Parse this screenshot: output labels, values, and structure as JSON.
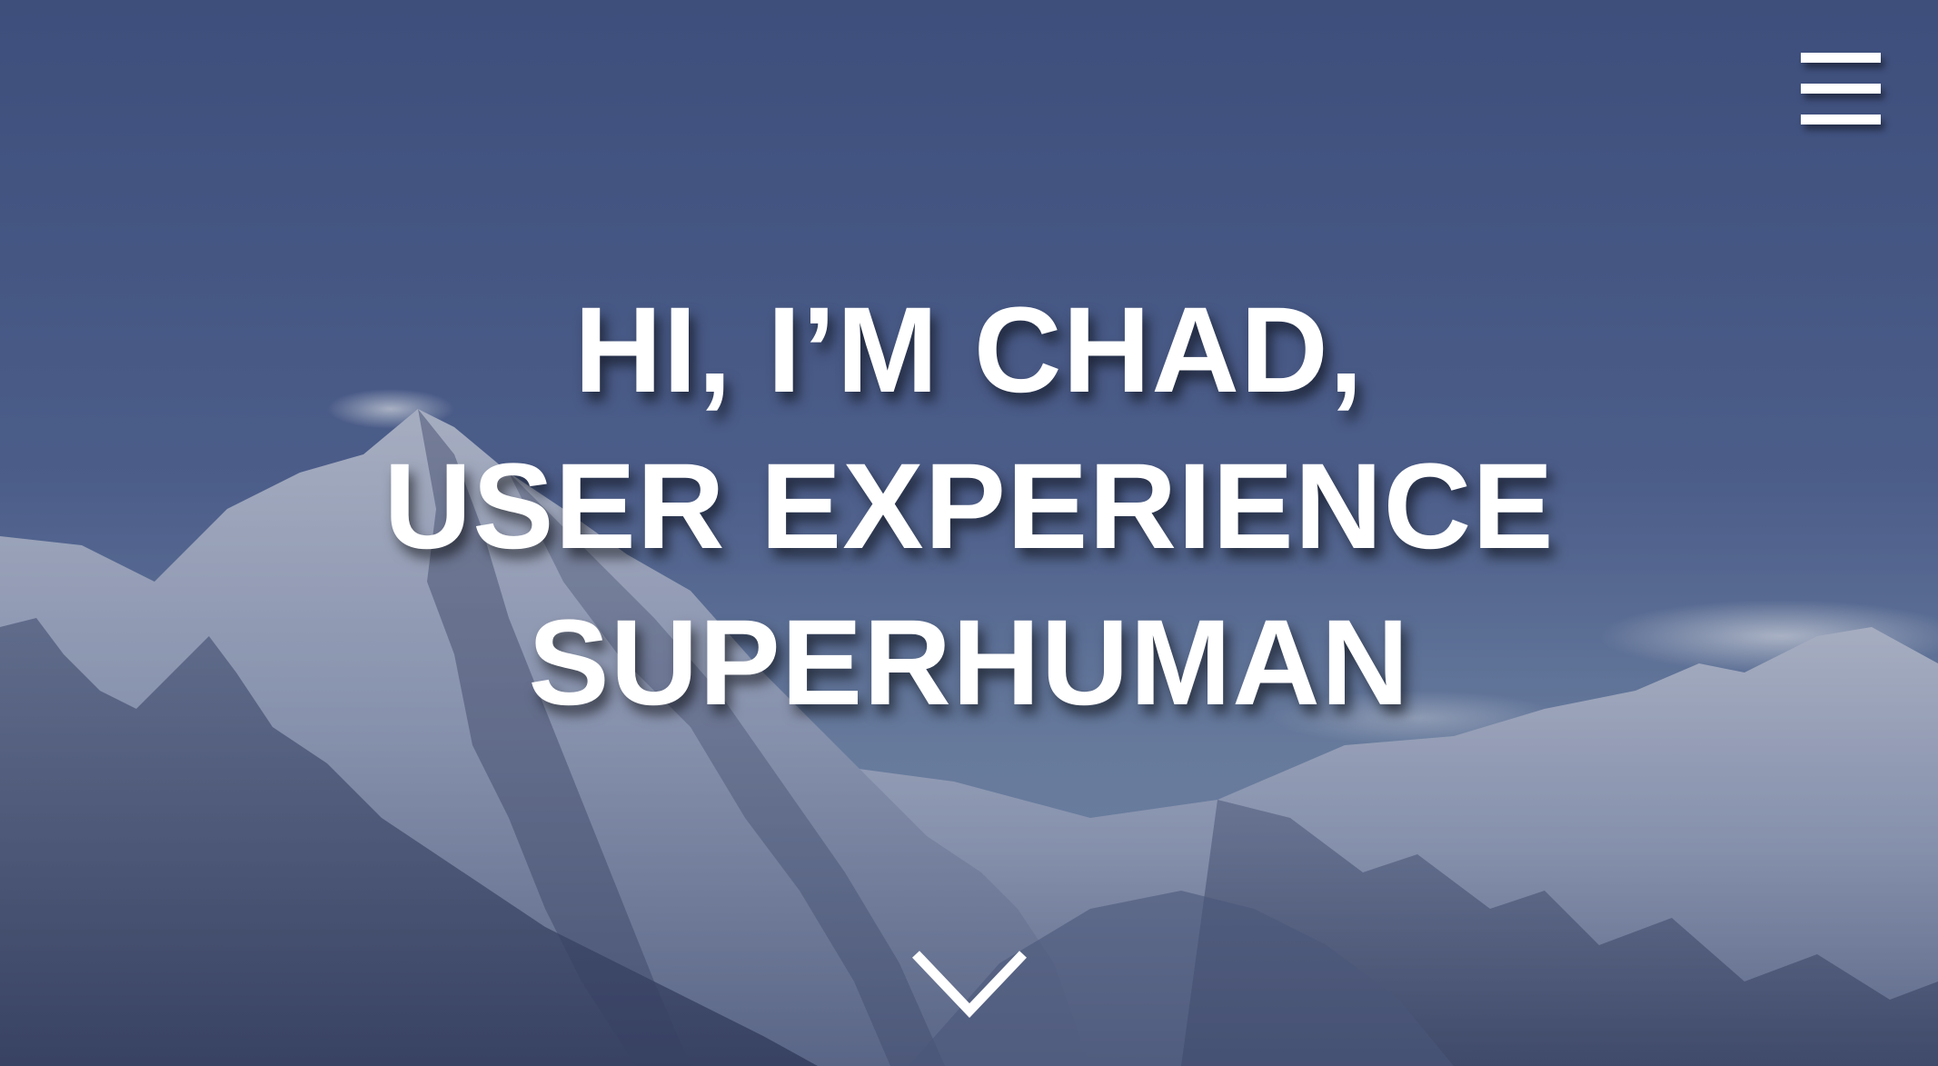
{
  "hero": {
    "headline_lines": [
      "HI, I’M CHAD,",
      "USER EXPERIENCE",
      "SUPERHUMAN"
    ]
  },
  "icons": {
    "menu": "hamburger-menu-icon",
    "scroll": "chevron-down-icon"
  },
  "colors": {
    "text": "#ffffff",
    "sky": "#4a5c8c",
    "snow": "#c9d0e0"
  }
}
